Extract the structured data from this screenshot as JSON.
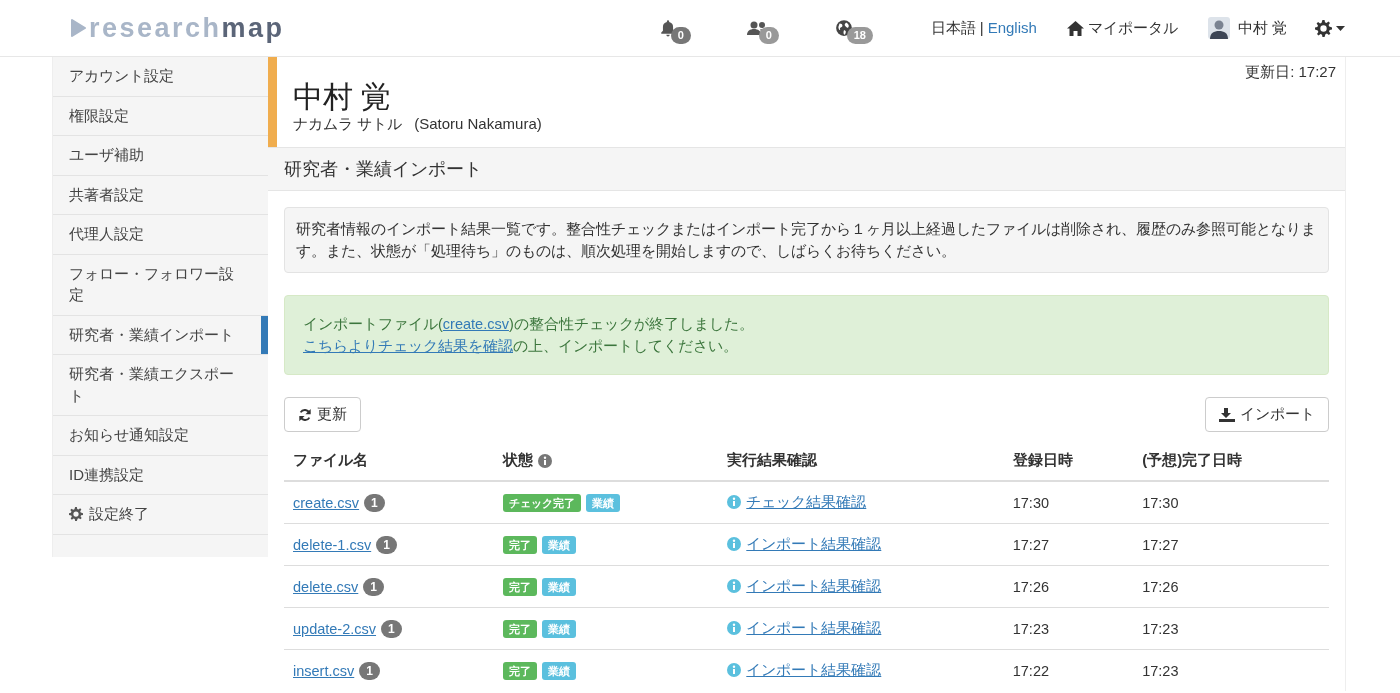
{
  "header": {
    "logo": {
      "light": "research",
      "dark": "map"
    },
    "notifications": [
      {
        "kind": "bell",
        "count": "0"
      },
      {
        "kind": "users",
        "count": "0"
      },
      {
        "kind": "globe",
        "count": "18"
      }
    ],
    "language_separator": "|",
    "languages": [
      {
        "label": "日本語",
        "selected": true
      },
      {
        "label": "English",
        "selected": false
      }
    ],
    "portal": "マイポータル",
    "user": "中村 覚"
  },
  "sidebar": {
    "items": [
      {
        "label": "アカウント設定",
        "kind": "link",
        "selected": false
      },
      {
        "label": "権限設定",
        "kind": "link",
        "selected": false
      },
      {
        "label": "ユーザ補助",
        "kind": "link",
        "selected": false
      },
      {
        "label": "共著者設定",
        "kind": "link",
        "selected": false
      },
      {
        "label": "代理人設定",
        "kind": "link",
        "selected": false
      },
      {
        "label": "フォロー・フォロワー設定",
        "kind": "link",
        "selected": false
      },
      {
        "label": "研究者・業績インポート",
        "kind": "link",
        "selected": true
      },
      {
        "label": "研究者・業績エクスポート",
        "kind": "link",
        "selected": false
      },
      {
        "label": "お知らせ通知設定",
        "kind": "link",
        "selected": false
      },
      {
        "label": "ID連携設定",
        "kind": "link",
        "selected": false
      },
      {
        "label": "設定終了",
        "kind": "exit",
        "selected": false
      }
    ]
  },
  "profile": {
    "name": "中村 覚",
    "kana": "ナカムラ サトル",
    "roman": "(Satoru Nakamura)",
    "updated": "更新日: 17:27"
  },
  "section_title": "研究者・業績インポート",
  "info_text": "研究者情報のインポート結果一覧です。整合性チェックまたはインポート完了から１ヶ月以上経過したファイルは削除され、履歴のみ参照可能となります。また、状態が「処理待ち」のものは、順次処理を開始しますので、しばらくお待ちください。",
  "success_alert": {
    "lines": [
      [
        {
          "kind": "text",
          "text": "インポートファイル("
        },
        {
          "kind": "link",
          "text": "create.csv"
        },
        {
          "kind": "text",
          "text": ")の整合性チェックが終了しました。"
        }
      ],
      [
        {
          "kind": "link",
          "text": "こちらよりチェック結果を確認"
        },
        {
          "kind": "text",
          "text": "の上、インポートしてください。"
        }
      ]
    ]
  },
  "buttons": {
    "refresh": "更新",
    "import": "インポート"
  },
  "table": {
    "columns": [
      {
        "label": "ファイル名",
        "info": false
      },
      {
        "label": "状態",
        "info": true
      },
      {
        "label": "実行結果確認",
        "info": false
      },
      {
        "label": "登録日時",
        "info": false
      },
      {
        "label": "(予想)完了日時",
        "info": false
      }
    ],
    "rows": [
      {
        "file": "create.csv",
        "count": "1",
        "tags": [
          {
            "text": "チェック完了",
            "color": "#5cb85c"
          },
          {
            "text": "業績",
            "color": "#5bc0de"
          }
        ],
        "result": "チェック結果確認",
        "registered": "17:30",
        "completed": "17:30"
      },
      {
        "file": "delete-1.csv",
        "count": "1",
        "tags": [
          {
            "text": "完了",
            "color": "#5cb85c"
          },
          {
            "text": "業績",
            "color": "#5bc0de"
          }
        ],
        "result": "インポート結果確認",
        "registered": "17:27",
        "completed": "17:27"
      },
      {
        "file": "delete.csv",
        "count": "1",
        "tags": [
          {
            "text": "完了",
            "color": "#5cb85c"
          },
          {
            "text": "業績",
            "color": "#5bc0de"
          }
        ],
        "result": "インポート結果確認",
        "registered": "17:26",
        "completed": "17:26"
      },
      {
        "file": "update-2.csv",
        "count": "1",
        "tags": [
          {
            "text": "完了",
            "color": "#5cb85c"
          },
          {
            "text": "業績",
            "color": "#5bc0de"
          }
        ],
        "result": "インポート結果確認",
        "registered": "17:23",
        "completed": "17:23"
      },
      {
        "file": "insert.csv",
        "count": "1",
        "tags": [
          {
            "text": "完了",
            "color": "#5cb85c"
          },
          {
            "text": "業績",
            "color": "#5bc0de"
          }
        ],
        "result": "インポート結果確認",
        "registered": "17:22",
        "completed": "17:23"
      }
    ]
  }
}
